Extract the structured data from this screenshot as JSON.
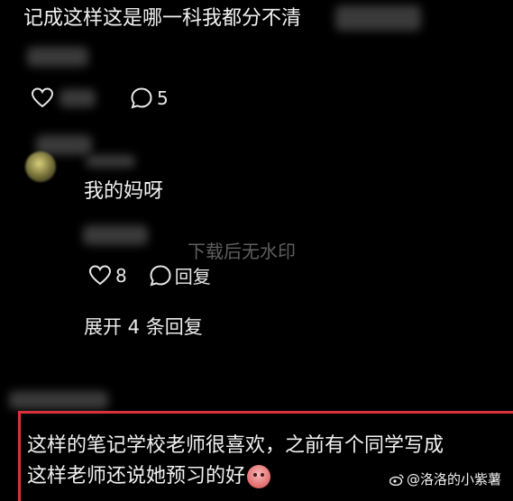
{
  "comment1": {
    "text": "记成这样这是哪一科我都分不清",
    "comment_count": "5"
  },
  "reply1": {
    "text": "我的妈呀",
    "like_count": "8",
    "reply_label": "回复"
  },
  "watermark": "下载后无水印",
  "expand": {
    "label": "展开 4 条回复"
  },
  "comment2": {
    "line1": "这样的笔记学校老师很喜欢，之前有个同学写成",
    "line2": "这样老师还说她预习的好"
  },
  "credit": {
    "text": "@洛洛的小紫薯"
  },
  "colors": {
    "background": "#000000",
    "highlight_border": "#d8323a",
    "text": "#f2f2f2"
  },
  "icons": [
    "heart-icon",
    "comment-bubble-icon",
    "emoji-icon",
    "weibo-logo-icon"
  ]
}
